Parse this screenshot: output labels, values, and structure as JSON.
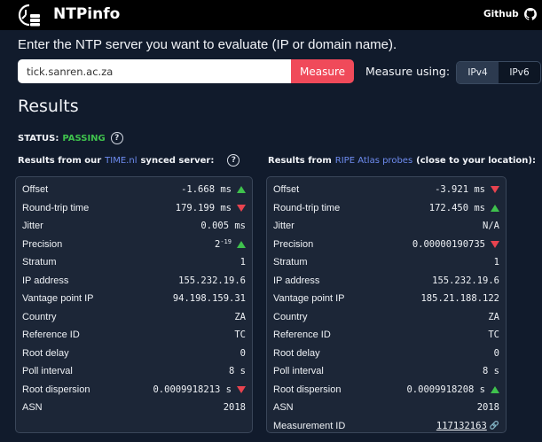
{
  "header": {
    "title": "NTPinfo",
    "github_label": "Github"
  },
  "form": {
    "prompt": "Enter the NTP server you want to evaluate (IP or domain name).",
    "server_value": "tick.sanren.ac.za",
    "measure_label": "Measure",
    "measure_using_label": "Measure using:",
    "ipv4_label": "IPv4",
    "ipv6_label": "IPv6",
    "selected": "IPv4"
  },
  "results": {
    "heading": "Results",
    "status_label": "STATUS:",
    "status_value": "PASSING",
    "status_color": "#3fc24d",
    "left": {
      "label_prefix": "Results from our",
      "link_text": "TIME.nl",
      "label_suffix": "synced server:",
      "rows": [
        {
          "label": "Offset",
          "value": "-1.668 ms",
          "trend": "up"
        },
        {
          "label": "Round-trip time",
          "value": "179.199 ms",
          "trend": "down"
        },
        {
          "label": "Jitter",
          "value": "0.005 ms"
        },
        {
          "label": "Precision",
          "value": "2",
          "exp": "-19",
          "trend": "up"
        },
        {
          "label": "Stratum",
          "value": "1"
        },
        {
          "label": "IP address",
          "value": "155.232.19.6"
        },
        {
          "label": "Vantage point IP",
          "value": "94.198.159.31"
        },
        {
          "label": "Country",
          "value": "ZA"
        },
        {
          "label": "Reference ID",
          "value": "TC"
        },
        {
          "label": "Root delay",
          "value": "0"
        },
        {
          "label": "Poll interval",
          "value": "8 s"
        },
        {
          "label": "Root dispersion",
          "value": "0.0009918213 s",
          "trend": "down"
        },
        {
          "label": "ASN",
          "value": "2018"
        }
      ]
    },
    "right": {
      "label_prefix": "Results from",
      "link_text": "RIPE Atlas probes",
      "label_suffix": "(close to your location):",
      "rows": [
        {
          "label": "Offset",
          "value": "-3.921 ms",
          "trend": "down"
        },
        {
          "label": "Round-trip time",
          "value": "172.450 ms",
          "trend": "up"
        },
        {
          "label": "Jitter",
          "value": "N/A"
        },
        {
          "label": "Precision",
          "value": "0.00000190735",
          "trend": "down"
        },
        {
          "label": "Stratum",
          "value": "1"
        },
        {
          "label": "IP address",
          "value": "155.232.19.6"
        },
        {
          "label": "Vantage point IP",
          "value": "185.21.188.122"
        },
        {
          "label": "Country",
          "value": "ZA"
        },
        {
          "label": "Reference ID",
          "value": "TC"
        },
        {
          "label": "Root delay",
          "value": "0"
        },
        {
          "label": "Poll interval",
          "value": "8 s"
        },
        {
          "label": "Root dispersion",
          "value": "0.0009918208 s",
          "trend": "up"
        },
        {
          "label": "ASN",
          "value": "2018"
        },
        {
          "label": "Measurement ID",
          "value": "117132163",
          "link": true
        }
      ]
    }
  },
  "colors": {
    "accent": "#f04a5a",
    "up": "#3fc24d",
    "down": "#e8434f",
    "link": "#6e8cf0"
  }
}
